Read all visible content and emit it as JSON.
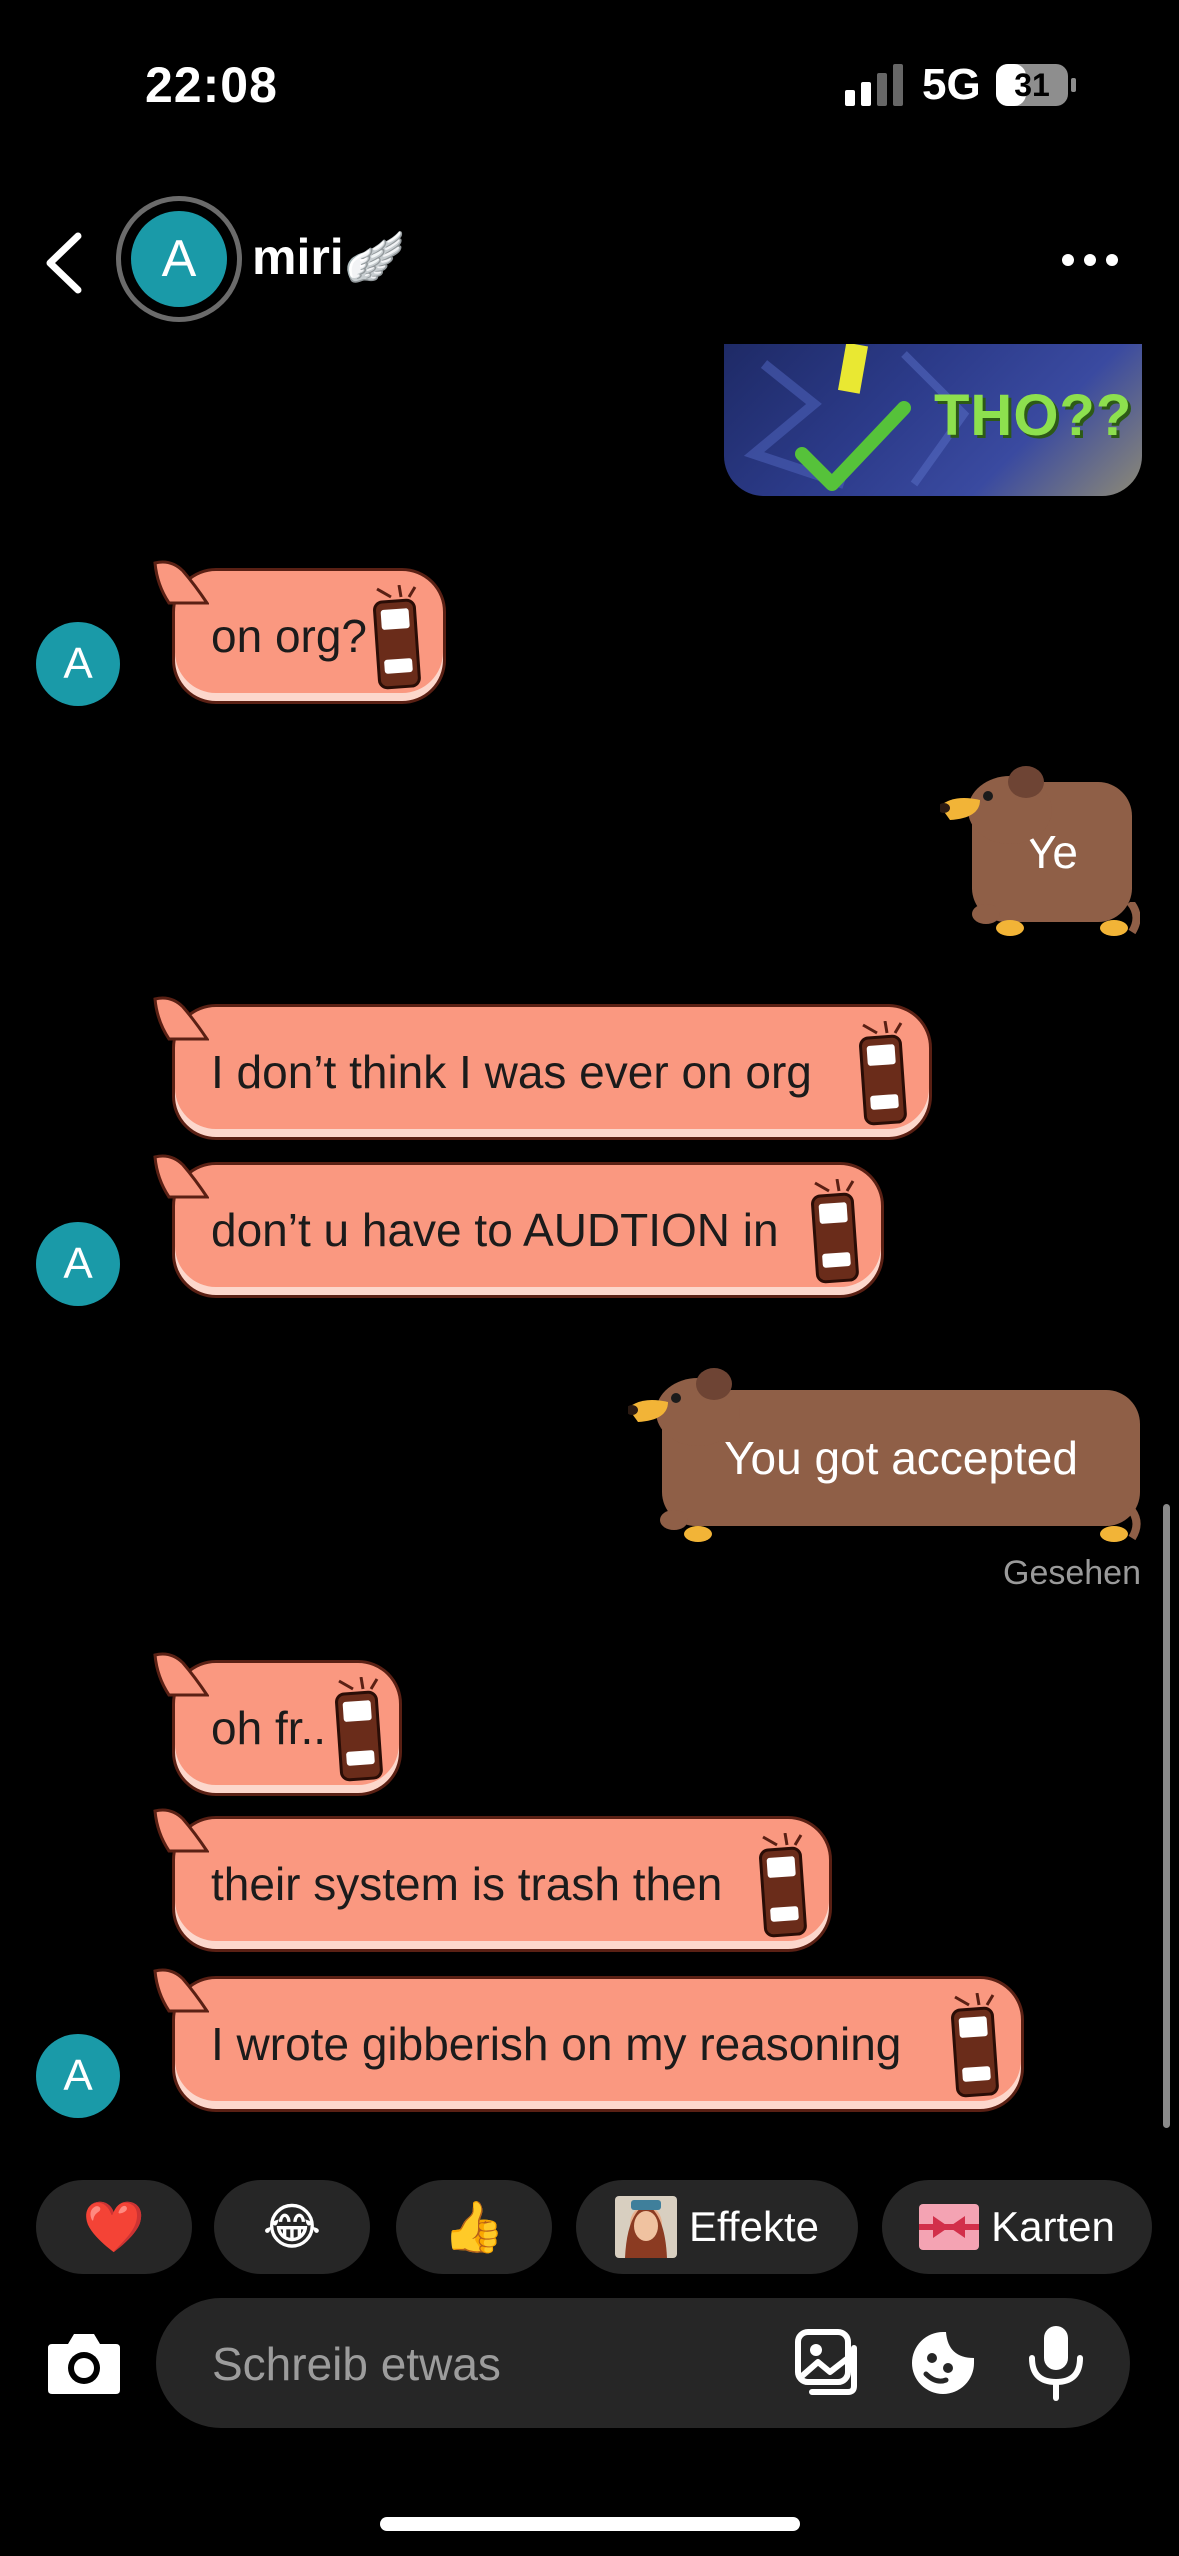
{
  "status_bar": {
    "time": "22:08",
    "network": "5G",
    "battery": "31"
  },
  "header": {
    "avatar_letter": "A",
    "contact_name": "miri",
    "name_emoji": "🪽"
  },
  "shared_image": {
    "text": "THO??"
  },
  "messages": [
    {
      "from": "them",
      "text": "on org?"
    },
    {
      "from": "me",
      "text": "Ye"
    },
    {
      "from": "them",
      "text": "I don’t think I was ever on org"
    },
    {
      "from": "them",
      "text": "don’t u have to AUDTION in"
    },
    {
      "from": "me",
      "text": "You got accepted"
    },
    {
      "from": "them",
      "text": "oh fr.."
    },
    {
      "from": "them",
      "text": "their system is trash then"
    },
    {
      "from": "them",
      "text": "I wrote gibberish on my reasoning"
    }
  ],
  "seen_label": "Gesehen",
  "avatar_letter_small": "A",
  "quick_reactions": [
    {
      "emoji": "❤️"
    },
    {
      "emoji": "😂"
    },
    {
      "emoji": "👍"
    },
    {
      "label": "Effekte"
    },
    {
      "label": "Karten"
    }
  ],
  "composer": {
    "placeholder": "Schreib etwas"
  },
  "colors": {
    "received_bubble": "#fa9880",
    "sent_bubble": "#8f5f47",
    "avatar": "#1a9aa8"
  }
}
